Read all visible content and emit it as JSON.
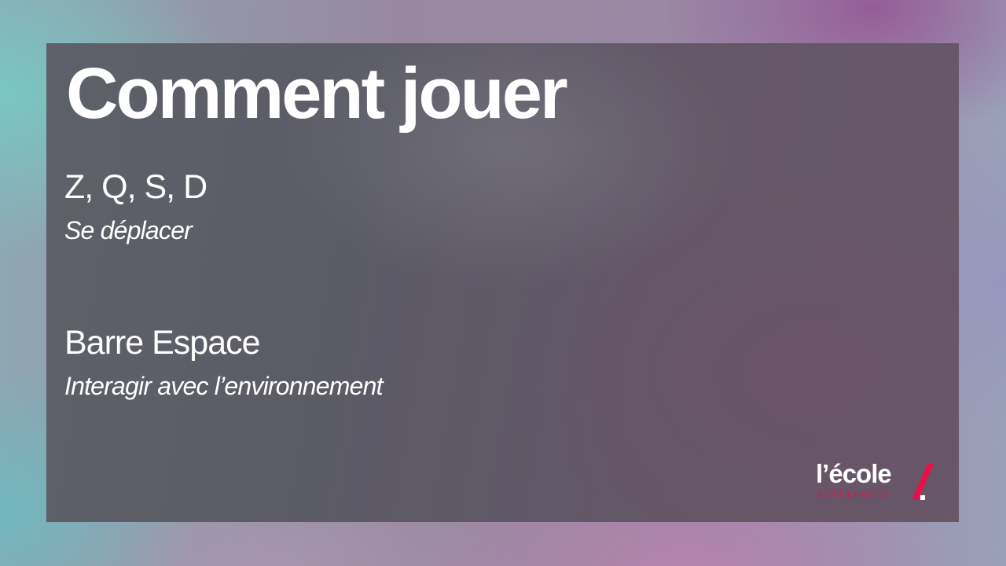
{
  "title": "Comment jouer",
  "controls": [
    {
      "key": "Z, Q, S, D",
      "action": "Se déplacer"
    },
    {
      "key": "Barre Espace",
      "action": "Interagir avec l’environnement"
    }
  ],
  "logo": {
    "main": "l’école",
    "sub": "multimédia",
    "accent_color": "#e8104a",
    "slash_icon": "slash-icon"
  },
  "colors": {
    "text": "#ffffff",
    "panel": "#5f5c67"
  }
}
